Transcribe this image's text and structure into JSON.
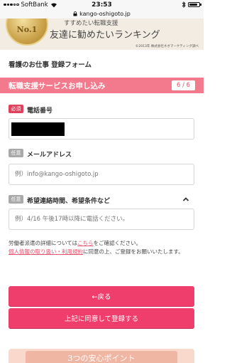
{
  "status_bar": {
    "carrier": "SoftBank",
    "time": "23:53",
    "battery_level": 0.85
  },
  "browser": {
    "url": "kango-oshigoto.jp"
  },
  "banner": {
    "medal_text": "No.1",
    "top_text": "すすめたい転職支援",
    "title": "友達に勧めたいランキング",
    "footnote": "©2013年 株式会社ネオマーケティング調べ"
  },
  "form": {
    "title": "看護のお仕事 登録フォーム",
    "service_title": "転職支援サービスお申し込み",
    "step": "6 / 6",
    "fields": [
      {
        "badge": "必須",
        "label": "電話番号",
        "value": "",
        "placeholder": ""
      },
      {
        "badge": "任意",
        "label": "メールアドレス",
        "value": "",
        "placeholder": "例）info@kango-oshigoto.jp"
      },
      {
        "badge": "任意",
        "label": "希望連絡時間、希望条件など",
        "value": "",
        "placeholder": "例）4/16 午後17時以降に電話ください。"
      }
    ],
    "info": {
      "line1_prefix": "労働者派遣の詳細については",
      "line1_link": "こちら",
      "line1_suffix": "をご確認ください。",
      "line2_link": "個人情報の取り扱い・利用規約",
      "line2_suffix": "に同意の上、ご登録をお願いいたします。"
    },
    "back_button": "←戻る",
    "submit_button": "上記に同意して登録する"
  },
  "bottom_banner": {
    "text": "3つの安心ポイント"
  },
  "colors": {
    "accent": "#ef3e6b",
    "service_bar": "#f37a8d",
    "required": "#e0415d",
    "optional": "#a9a9a9"
  }
}
